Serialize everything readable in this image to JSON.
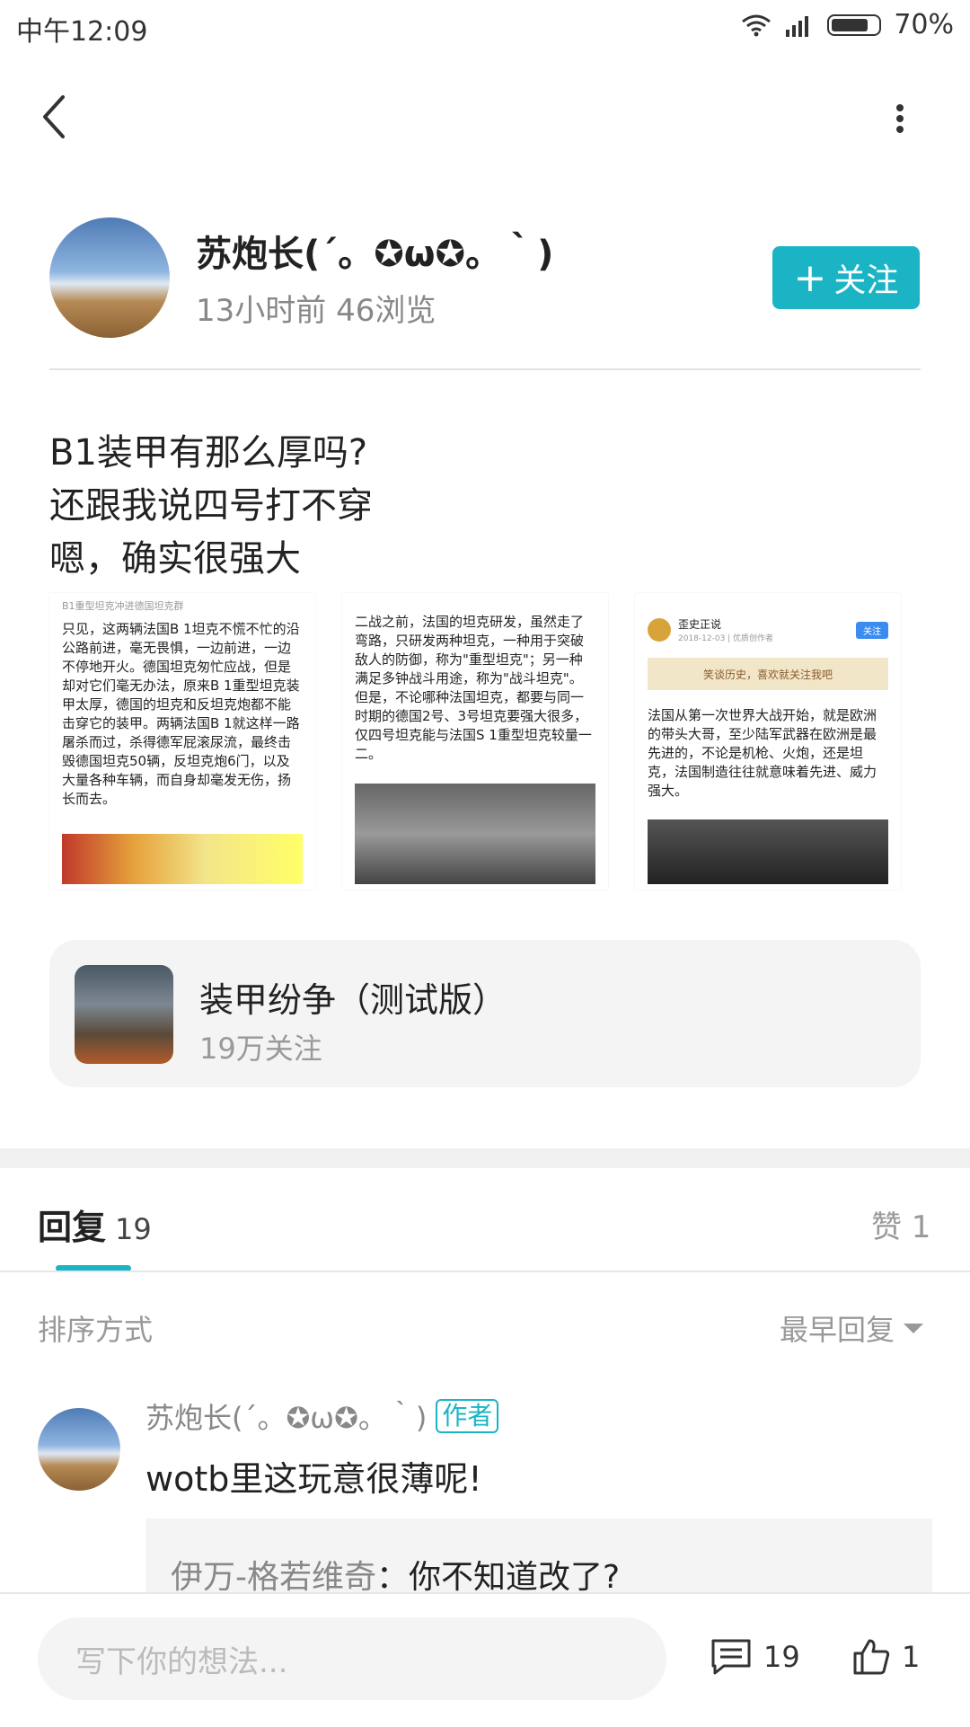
{
  "status_bar": {
    "time": "中午12:09",
    "battery": "70%"
  },
  "author": {
    "name": "苏炮长(´。✪ω✪。｀)",
    "meta": "13小时前  46浏览"
  },
  "follow_label": "关注",
  "post": {
    "lines": [
      "B1装甲有那么厚吗?",
      "还跟我说四号打不穿",
      "嗯，确实很强大"
    ]
  },
  "images": {
    "img1": {
      "caption": "B1重型坦克冲进德国坦克群",
      "text": "只见，这两辆法国B 1坦克不慌不忙的沿公路前进，毫无畏惧，一边前进，一边不停地开火。德国坦克匆忙应战，但是却对它们毫无办法，原来B 1重型坦克装甲太厚，德国的坦克和反坦克炮都不能击穿它的装甲。两辆法国B 1就这样一路屠杀而过，杀得德军屁滚尿流，最终击毁德国坦克50辆，反坦克炮6门，以及大量各种车辆，而自身却毫发无伤，扬长而去。"
    },
    "img2": {
      "text": "二战之前，法国的坦克研发，虽然走了弯路，只研发两种坦克，一种用于突破敌人的防御，称为\"重型坦克\"；另一种满足多钟战斗用途，称为\"战斗坦克\"。但是，不论哪种法国坦克，都要与同一时期的德国2号、3号坦克要强大很多，仅四号坦克能与法国S 1重型坦克较量一二。"
    },
    "img3": {
      "account": "歪史正说",
      "date": "2018-12-03 | 优质创作者",
      "button": "关注",
      "banner": "笑谈历史，喜欢就关注我吧",
      "text": "法国从第一次世界大战开始，就是欧洲的带头大哥，至少陆军武器在欧洲是最先进的，不论是机枪、火炮，还是坦克，法国制造往往就意味着先进、威力强大。"
    }
  },
  "community": {
    "title": "装甲纷争（测试版）",
    "followers": "19万关注"
  },
  "tabs": {
    "reply_label": "回复",
    "reply_count": "19",
    "like_label": "赞 1"
  },
  "sort": {
    "label": "排序方式",
    "value": "最早回复"
  },
  "comment": {
    "author": "苏炮长(´。✪ω✪。｀)",
    "tag": "作者",
    "text": "wotb里这玩意很薄呢!",
    "reply_user": "伊万-格若维奇",
    "reply_text": "：你不知道改了?"
  },
  "bottom_bar": {
    "placeholder": "写下你的想法...",
    "comment_count": "19",
    "like_count": "1"
  }
}
